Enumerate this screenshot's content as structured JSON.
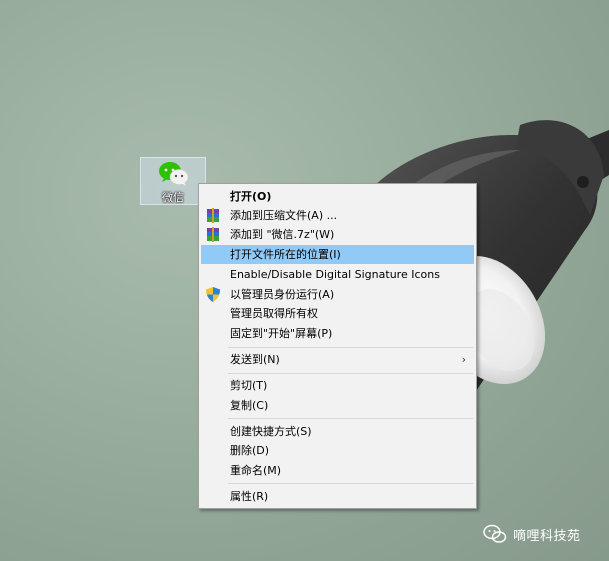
{
  "desktop": {
    "icon": {
      "label": "微信",
      "icon_name": "wechat-icon",
      "color": "#2dc100"
    }
  },
  "context_menu": {
    "items": [
      {
        "label": "打开(O)",
        "bold": true
      },
      {
        "label": "添加到压缩文件(A) ...",
        "icon": "winrar-icon"
      },
      {
        "label": "添加到 \"微信.7z\"(W)",
        "icon": "winrar-icon"
      },
      {
        "label": "打开文件所在的位置(I)",
        "highlighted": true
      },
      {
        "label": "Enable/Disable Digital Signature Icons"
      },
      {
        "label": "以管理员身份运行(A)",
        "icon": "uac-shield-icon"
      },
      {
        "label": "管理员取得所有权"
      },
      {
        "label": "固定到\"开始\"屏幕(P)"
      },
      {
        "label": "发送到(N)",
        "submenu": true
      },
      {
        "label": "剪切(T)"
      },
      {
        "label": "复制(C)"
      },
      {
        "label": "创建快捷方式(S)"
      },
      {
        "label": "删除(D)"
      },
      {
        "label": "重命名(M)"
      },
      {
        "label": "属性(R)"
      }
    ],
    "submenu_arrow": "›",
    "highlight_color": "#91c9f7"
  },
  "watermark": {
    "text": "嘀哩科技苑",
    "icon": "wechat-official-account-icon"
  }
}
